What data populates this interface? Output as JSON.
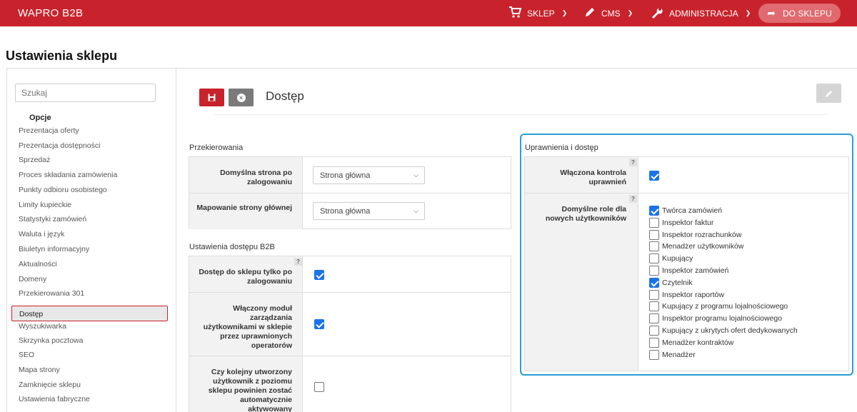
{
  "topbar": {
    "brand": "WAPRO B2B",
    "nav": [
      {
        "label": "SKLEP",
        "icon": "cart-icon"
      },
      {
        "label": "CMS",
        "icon": "pencil-icon"
      },
      {
        "label": "ADMINISTRACJA",
        "icon": "wrench-icon"
      }
    ],
    "shop_button": "DO SKLEPU"
  },
  "page_title": "Ustawienia sklepu",
  "sidebar": {
    "search_placeholder": "Szukaj",
    "heading": "Opcje",
    "items": [
      "Prezentacja oferty",
      "Prezentacja dostępności",
      "Sprzedaż",
      "Proces składania zamówienia",
      "Punkty odbioru osobistego",
      "Limity kupieckie",
      "Statystyki zamówień",
      "Waluta i język",
      "Biuletyn informacyjny",
      "Aktualności",
      "Domeny",
      "Przekierowania 301",
      "Dostęp",
      "Wyszukiwarka",
      "Skrzynka pocztowa",
      "SEO",
      "Mapa strony",
      "Zamknięcie sklepu",
      "Ustawienia fabryczne"
    ],
    "active_index": 12
  },
  "section": {
    "title": "Dostęp"
  },
  "redirects": {
    "label": "Przekierowania",
    "rows": [
      {
        "label": "Domyślna strona po zalogowaniu",
        "value": "Strona główna"
      },
      {
        "label": "Mapowanie strony głównej",
        "value": "Strona główna"
      }
    ]
  },
  "b2b_access": {
    "label": "Ustawienia dostępu B2B",
    "rows": [
      {
        "label": "Dostęp do sklepu tylko po zalogowaniu",
        "checked": true
      },
      {
        "label": "Włączony moduł zarządzania użytkownikami w sklepie przez uprawnionych operatorów",
        "checked": true
      },
      {
        "label": "Czy kolejny utworzony użytkownik z poziomu sklepu powinien zostać automatycznie aktywowany",
        "checked": false
      }
    ]
  },
  "permissions": {
    "label": "Uprawnienia i dostęp",
    "control_label": "Włączona kontrola uprawnień",
    "control_checked": true,
    "roles_label": "Domyślne role dla nowych użytkowników",
    "roles": [
      {
        "name": "Twórca zamówień",
        "checked": true
      },
      {
        "name": "Inspektor faktur",
        "checked": false
      },
      {
        "name": "Inspektor rozrachunków",
        "checked": false
      },
      {
        "name": "Menadżer użytkowników",
        "checked": false
      },
      {
        "name": "Kupujący",
        "checked": false
      },
      {
        "name": "Inspektor zamówień",
        "checked": false
      },
      {
        "name": "Czytelnik",
        "checked": true
      },
      {
        "name": "Inspektor raportów",
        "checked": false
      },
      {
        "name": "Kupujący z programu lojalnościowego",
        "checked": false
      },
      {
        "name": "Inspektor programu lojalnościowego",
        "checked": false
      },
      {
        "name": "Kupujący z ukrytych ofert dedykowanych",
        "checked": false
      },
      {
        "name": "Menadżer kontraktów",
        "checked": false
      },
      {
        "name": "Menadżer",
        "checked": false
      }
    ]
  },
  "help_mark": "?",
  "colors": {
    "brand": "#c8232c",
    "accent": "#1a73e8",
    "highlight": "#2a9fd6"
  }
}
